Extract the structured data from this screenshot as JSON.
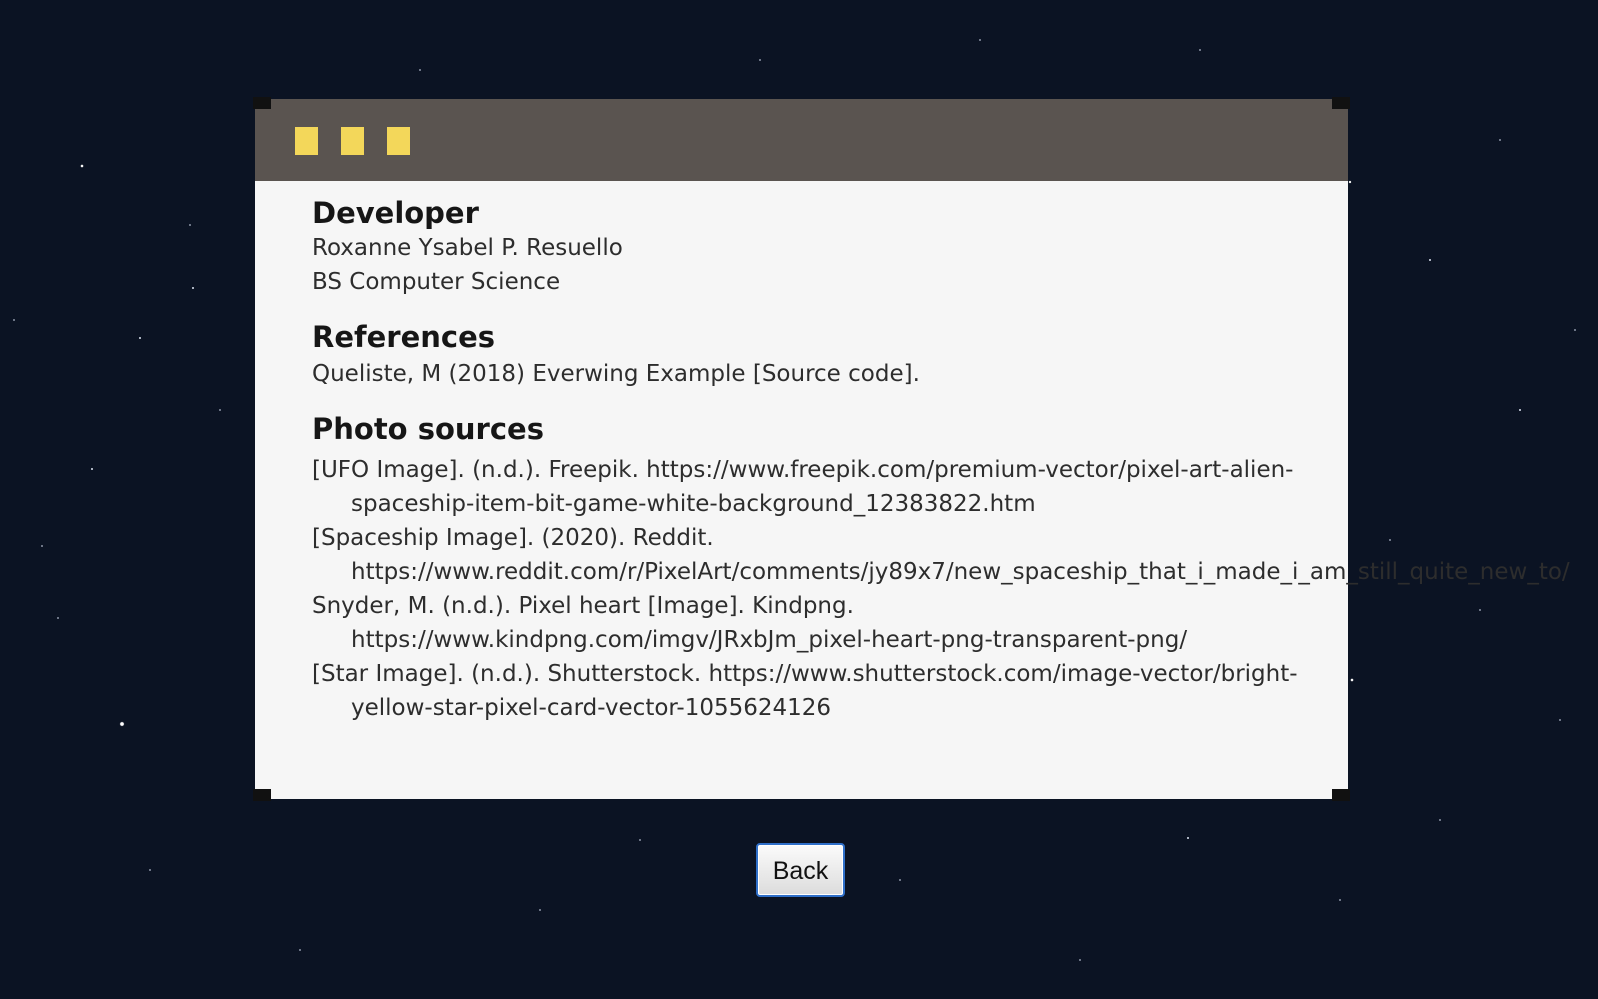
{
  "window": {
    "accent_color": "#f3d75a",
    "titlebar_color": "#5a5450",
    "dots": [
      "square-icon",
      "square-icon",
      "square-icon"
    ]
  },
  "developer": {
    "heading": "Developer",
    "name": "Roxanne Ysabel P. Resuello",
    "program": "BS Computer Science"
  },
  "references": {
    "heading": "References",
    "items": [
      "Queliste, M (2018) Everwing Example [Source code]."
    ]
  },
  "photo_sources": {
    "heading": "Photo sources",
    "items": [
      "[UFO Image]. (n.d.). Freepik. https://www.freepik.com/premium-vector/pixel-art-alien-spaceship-item-bit-game-white-background_12383822.htm",
      "[Spaceship Image]. (2020). Reddit. https://www.reddit.com/r/PixelArt/comments/jy89x7/new_spaceship_that_i_made_i_am_still_quite_new_to/",
      "Snyder, M. (n.d.). Pixel heart [Image]. Kindpng. https://www.kindpng.com/imgv/JRxbJm_pixel-heart-png-transparent-png/",
      "[Star Image]. (n.d.). Shutterstock. https://www.shutterstock.com/image-vector/bright-yellow-star-pixel-card-vector-1055624126"
    ]
  },
  "actions": {
    "back_label": "Back"
  }
}
